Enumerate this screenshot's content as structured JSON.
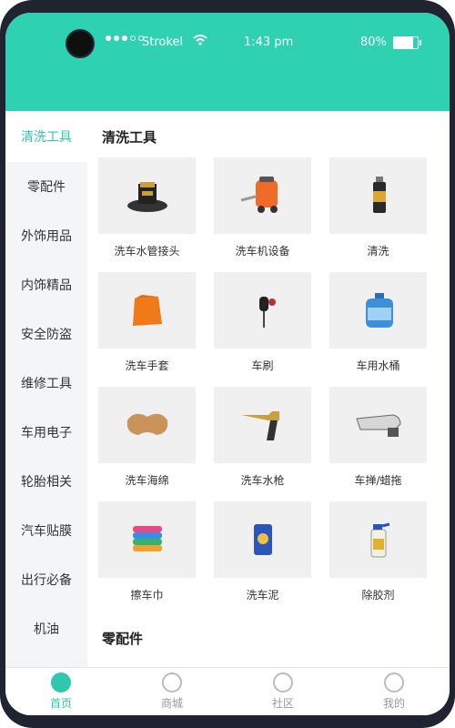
{
  "status": {
    "carrier": "Strokel",
    "time": "1:43 pm",
    "battery": "80%"
  },
  "sidebar": {
    "items": [
      {
        "label": "清洗工具",
        "active": true
      },
      {
        "label": "零配件"
      },
      {
        "label": "外饰用品"
      },
      {
        "label": "内饰精品"
      },
      {
        "label": "安全防盗"
      },
      {
        "label": "维修工具"
      },
      {
        "label": "车用电子"
      },
      {
        "label": "轮胎相关"
      },
      {
        "label": "汽车贴膜"
      },
      {
        "label": "出行必备"
      },
      {
        "label": "机油"
      }
    ]
  },
  "main": {
    "section1_title": "清洗工具",
    "products": [
      {
        "label": "洗车水管接头",
        "icon": "hose-connector-icon"
      },
      {
        "label": "洗车机设备",
        "icon": "washer-machine-icon"
      },
      {
        "label": "清洗",
        "icon": "spray-can-icon"
      },
      {
        "label": "洗车手套",
        "icon": "glove-icon"
      },
      {
        "label": "车刷",
        "icon": "brush-icon"
      },
      {
        "label": "车用水桶",
        "icon": "water-bucket-icon"
      },
      {
        "label": "洗车海绵",
        "icon": "sponge-icon"
      },
      {
        "label": "洗车水枪",
        "icon": "water-gun-icon"
      },
      {
        "label": "车掸/蜡拖",
        "icon": "duster-icon"
      },
      {
        "label": "擦车巾",
        "icon": "towel-icon"
      },
      {
        "label": "洗车泥",
        "icon": "clay-icon"
      },
      {
        "label": "除胶剂",
        "icon": "remover-bottle-icon"
      }
    ],
    "section2_title": "零配件"
  },
  "tabbar": {
    "items": [
      {
        "label": "首页",
        "active": true
      },
      {
        "label": "商城"
      },
      {
        "label": "社区"
      },
      {
        "label": "我的"
      }
    ]
  },
  "colors": {
    "accent": "#2fc7ad",
    "statusbar": "#2fd1b3"
  }
}
